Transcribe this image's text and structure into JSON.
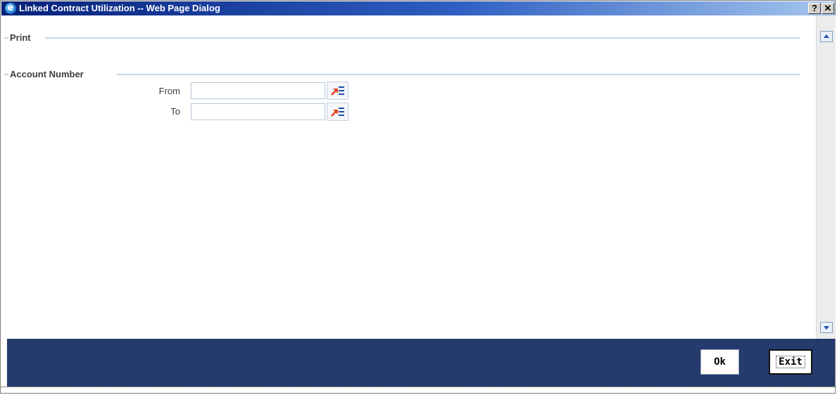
{
  "window": {
    "title": "Linked Contract Utilization -- Web Page Dialog",
    "help_label": "?",
    "close_label": "✕"
  },
  "sections": {
    "print_label": "Print",
    "account_number_label": "Account Number"
  },
  "fields": {
    "from_label": "From",
    "from_value": "",
    "to_label": "To",
    "to_value": ""
  },
  "footer": {
    "ok_label": "Ok",
    "exit_label": "Exit"
  },
  "colors": {
    "titlebar_start": "#06217a",
    "titlebar_end": "#a6c6ee",
    "footer_bg": "#22386b",
    "section_rule": "#c3d5ea",
    "lov_arrow": "#e8401c",
    "lov_lines": "#1f4fa3"
  },
  "icons": {
    "window_icon": "ie-globe-icon",
    "lov_icon": "list-of-values-icon",
    "scroll_up": "arrow-up-icon",
    "scroll_down": "arrow-down-icon"
  }
}
